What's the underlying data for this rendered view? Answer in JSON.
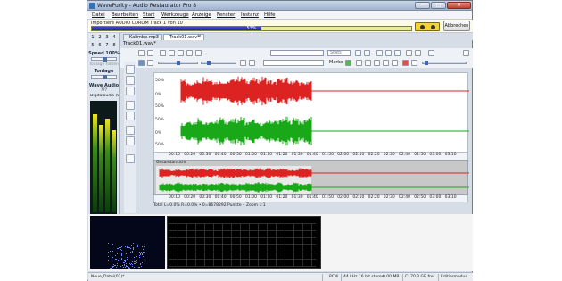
{
  "window": {
    "title": "WavePurity - Audio Restaurator Pro 8"
  },
  "menu": {
    "items": [
      "Datei",
      "Bearbeiten",
      "Start",
      "Werkzeuge",
      "Anzeige",
      "Fenster",
      "Instanz",
      "Hilfe"
    ]
  },
  "progress": {
    "label": "Importiere AUDIO CDROM Track 1 von 10",
    "percent_text": "53%",
    "percent": 53,
    "cancel_label": "Abbrechen"
  },
  "left_panel": {
    "numbers": [
      "1",
      "2",
      "3",
      "4",
      "5",
      "6",
      "7",
      "8"
    ],
    "speed_label": "Speed 100%",
    "speed_disabled_label": "Tonlage halten",
    "pitch_label": "Tonlage",
    "wave_audio_label": "Wave Audio",
    "wave_audio_value": "???",
    "device_label": "Digitalaudio (S/"
  },
  "tabs": [
    {
      "label": "Kalimbe.mp3",
      "active": false
    },
    {
      "label": "Track01.wav*",
      "active": true
    }
  ],
  "document": {
    "title": "Track01.wav*"
  },
  "toolbar": {
    "field_value": "Stats",
    "marker_label": "Marke"
  },
  "waveform": {
    "db_labels_top": [
      "50%",
      "0%",
      "50%"
    ],
    "db_labels_bottom": [
      "50%",
      "0%",
      "50%"
    ],
    "colors": {
      "left_channel": "#dd2222",
      "right_channel": "#18a818",
      "background": "#ffffff"
    }
  },
  "timeline": {
    "ticks": [
      "00:10",
      "00:20",
      "00:30",
      "00:40",
      "00:50",
      "01:00",
      "01:10",
      "01:20",
      "01:30",
      "01:40",
      "01:50",
      "02:00",
      "02:10",
      "02:20",
      "02:30",
      "02:40",
      "02:50",
      "03:00",
      "03:10"
    ]
  },
  "overview": {
    "label": "Gesamtansicht",
    "ticks": [
      "00:10",
      "00:20",
      "00:30",
      "00:40",
      "00:50",
      "01:00",
      "01:10",
      "01:20",
      "01:30",
      "01:40",
      "01:50",
      "02:00",
      "02:10",
      "02:20",
      "02:30",
      "02:40",
      "02:50",
      "03:00",
      "03:10"
    ]
  },
  "selection_info": "Total L=0.0% R=0.0% • 0=8678292 Punkte • Zoom 1:1",
  "statusbar": {
    "file": "Neue_Datei(02)*",
    "format": "PCM",
    "rate": "44 kHz 16 bit stereo",
    "size": "0.00 MB",
    "disk": "C: 70.3 GB frei",
    "mode": "Editiermodus"
  }
}
